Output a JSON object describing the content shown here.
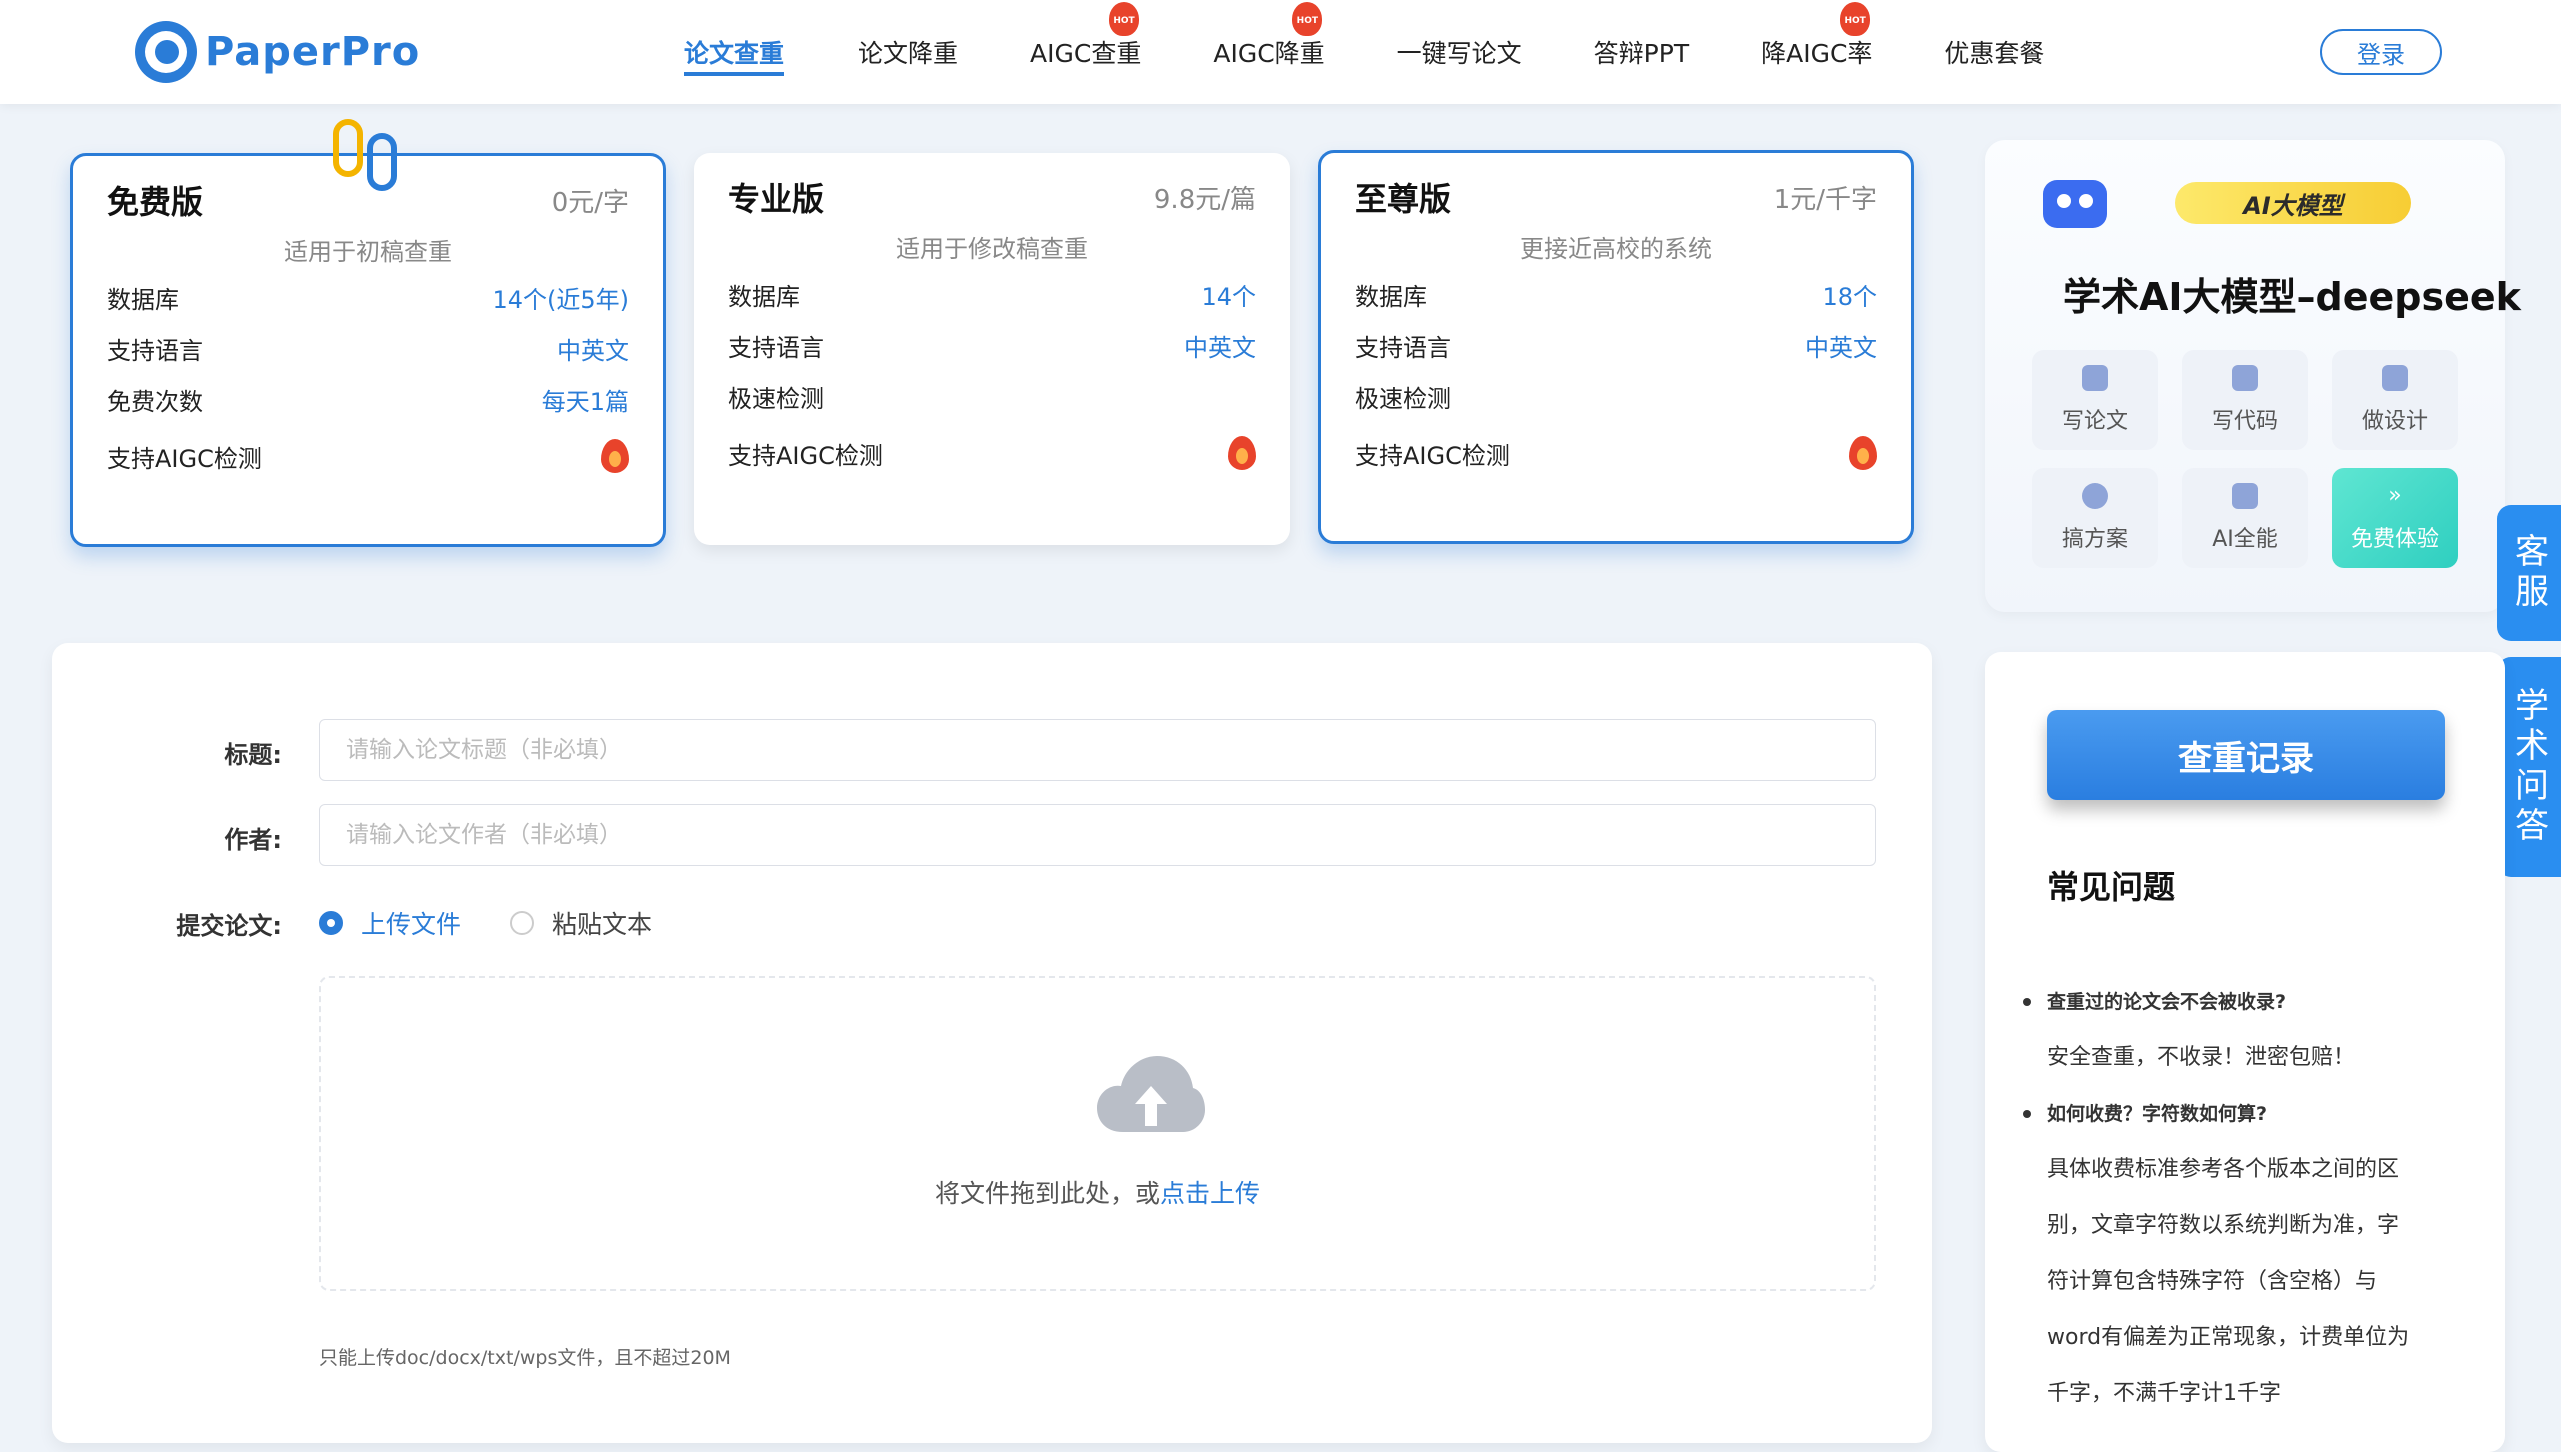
{
  "brand": {
    "name": "PaperPro",
    "color": "#2a7cd7"
  },
  "nav": {
    "items": [
      {
        "label": "论文查重",
        "active": true,
        "hot": false
      },
      {
        "label": "论文降重",
        "active": false,
        "hot": false
      },
      {
        "label": "AIGC查重",
        "active": false,
        "hot": true
      },
      {
        "label": "AIGC降重",
        "active": false,
        "hot": true
      },
      {
        "label": "一键写论文",
        "active": false,
        "hot": false
      },
      {
        "label": "答辩PPT",
        "active": false,
        "hot": false
      },
      {
        "label": "降AIGC率",
        "active": false,
        "hot": true
      },
      {
        "label": "优惠套餐",
        "active": false,
        "hot": false
      }
    ],
    "hot_badge": "HOT",
    "login_label": "登录"
  },
  "plans": [
    {
      "title": "免费版",
      "price": "0元/字",
      "subtitle": "适用于初稿查重",
      "selected": true,
      "rows": [
        {
          "label": "数据库",
          "value": "14个(近5年)"
        },
        {
          "label": "支持语言",
          "value": "中英文"
        },
        {
          "label": "免费次数",
          "value": "每天1篇"
        },
        {
          "label": "支持AIGC检测",
          "icon": "flame-icon"
        }
      ]
    },
    {
      "title": "专业版",
      "price": "9.8元/篇",
      "subtitle": "适用于修改稿查重",
      "selected": false,
      "rows": [
        {
          "label": "数据库",
          "value": "14个"
        },
        {
          "label": "支持语言",
          "value": "中英文"
        },
        {
          "label": "极速检测",
          "value": ""
        },
        {
          "label": "支持AIGC检测",
          "icon": "flame-icon"
        }
      ]
    },
    {
      "title": "至尊版",
      "price": "1元/千字",
      "subtitle": "更接近高校的系统",
      "selected": true,
      "rows": [
        {
          "label": "数据库",
          "value": "18个"
        },
        {
          "label": "支持语言",
          "value": "中英文"
        },
        {
          "label": "极速检测",
          "value": ""
        },
        {
          "label": "支持AIGC检测",
          "icon": "flame-icon"
        }
      ]
    }
  ],
  "ai_promo": {
    "badge": "AI大模型",
    "title": "学术AI大模型–deepseek",
    "tiles": [
      "写论文",
      "写代码",
      "做设计",
      "搞方案",
      "AI全能",
      "免费体验"
    ]
  },
  "side_tabs": [
    "客服",
    "学术问答"
  ],
  "form": {
    "title_label": "标题:",
    "title_placeholder": "请输入论文标题（非必填）",
    "author_label": "作者:",
    "author_placeholder": "请输入论文作者（非必填）",
    "submit_label": "提交论文:",
    "mode_upload": "上传文件",
    "mode_paste": "粘贴文本",
    "selected_mode": "上传文件",
    "drop_text": "将文件拖到此处，或",
    "drop_link": "点击上传",
    "hint": "只能上传doc/docx/txt/wps文件，且不超过20M"
  },
  "right_panel": {
    "record_button": "查重记录",
    "faq_title": "常见问题",
    "faq": [
      {
        "q": "查重过的论文会不会被收录?",
        "a": [
          "安全查重，不收录！泄密包赔！"
        ]
      },
      {
        "q": "如何收费？字符数如何算?",
        "a": [
          "具体收费标准参考各个版本之间的区",
          "别，文章字符数以系统判断为准，字",
          "符计算包含特殊字符（含空格）与",
          "word有偏差为正常现象，计费单位为",
          "千字，不满千字计1千字"
        ]
      }
    ]
  },
  "colors": {
    "accent": "#2a7cd7",
    "hot": "#e8432b",
    "tile_highlight": "#35d2c2",
    "side_tab": "#2a8ef0"
  }
}
